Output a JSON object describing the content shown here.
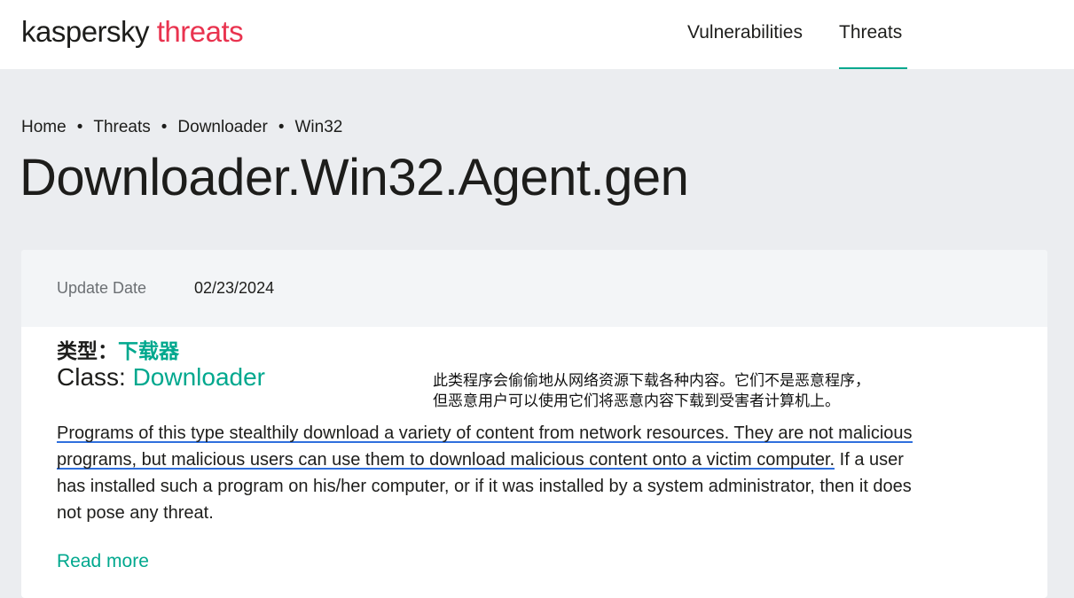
{
  "header": {
    "logo_brand": "kaspersky",
    "logo_section": "threats",
    "nav": [
      "Vulnerabilities",
      "Threats"
    ],
    "active_nav": "Threats"
  },
  "breadcrumb": [
    "Home",
    "Threats",
    "Downloader",
    "Win32"
  ],
  "page_title": "Downloader.Win32.Agent.gen",
  "card": {
    "update_label": "Update Date",
    "update_value": "02/23/2024",
    "cn_type_label": "类型：",
    "cn_type_value": "下载器",
    "class_label": "Class: ",
    "class_value": "Downloader",
    "cn_note_line1": "此类程序会偷偷地从网络资源下载各种内容。它们不是恶意程序，",
    "cn_note_line2": "但恶意用户可以使用它们将恶意内容下载到受害者计算机上。",
    "description_highlight": "Programs of this type stealthily download a variety of content from network resources. They are not malicious programs, but malicious users can use them to download malicious content onto a victim computer.",
    "description_rest": " If a user has installed such a program on his/her computer, or if it was installed by a system administrator, then it does not pose any threat.",
    "read_more": "Read more"
  },
  "colors": {
    "accent": "#00a88e",
    "brand_red": "#e9334f",
    "underline_blue": "#2f6fdd",
    "page_bg": "#ebedf0"
  }
}
